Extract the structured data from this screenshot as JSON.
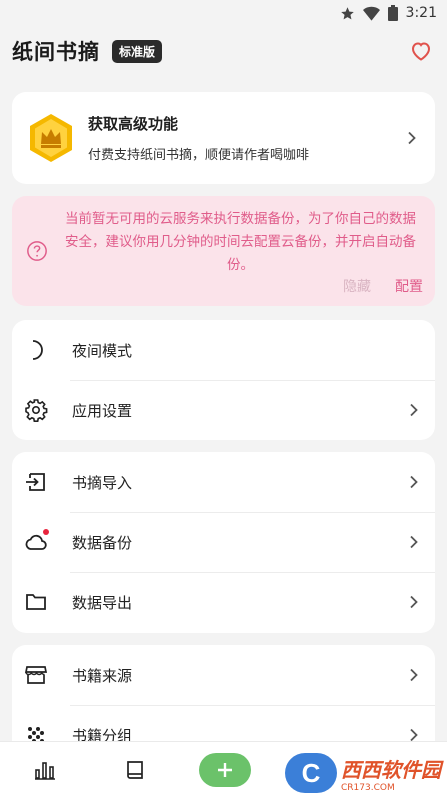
{
  "statusbar": {
    "time": "3:21"
  },
  "header": {
    "title": "纸间书摘",
    "badge": "标准版"
  },
  "premium": {
    "title": "获取高级功能",
    "subtitle": "付费支持纸间书摘，顺便请作者喝咖啡"
  },
  "notice": {
    "message": "当前暂无可用的云服务来执行数据备份，为了你自己的数据安全，建议你用几分钟的时间去配置云备份，并开启自动备份。",
    "hide_label": "隐藏",
    "config_label": "配置"
  },
  "group1": [
    {
      "label": "夜间模式",
      "icon": "moon-icon"
    },
    {
      "label": "应用设置",
      "icon": "gear-icon"
    }
  ],
  "group2": [
    {
      "label": "书摘导入",
      "icon": "import-icon"
    },
    {
      "label": "数据备份",
      "icon": "cloud-icon"
    },
    {
      "label": "数据导出",
      "icon": "folder-icon"
    }
  ],
  "group3": [
    {
      "label": "书籍来源",
      "icon": "store-icon"
    },
    {
      "label": "书籍分组",
      "icon": "grid-dots-icon"
    }
  ],
  "watermark": {
    "logo": "C",
    "main": "西西软件园",
    "sub": "CR173.COM"
  },
  "colors": {
    "accent": "#e05c8a",
    "notice_bg": "#fbe3ea",
    "add_button": "#6bc26a",
    "heart": "#e0524c"
  }
}
